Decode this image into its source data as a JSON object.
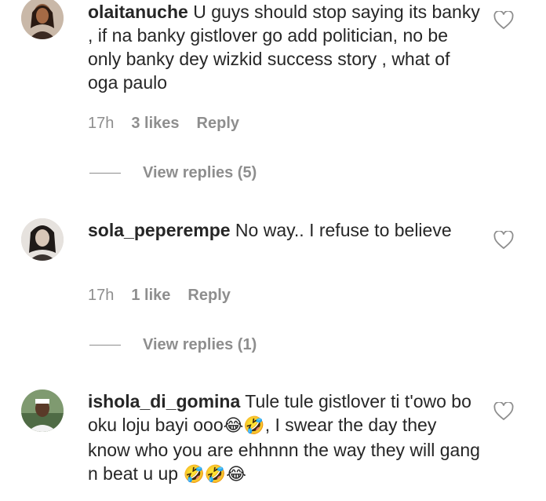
{
  "comments": [
    {
      "username": "olaitanuche",
      "text": "U guys should stop saying its banky , if na banky gistlover go add politician, no be only banky dey wizkid success story , what of oga paulo",
      "time": "17h",
      "likes": "3 likes",
      "reply_label": "Reply",
      "view_replies": "View replies (5)"
    },
    {
      "username": "sola_peperempe",
      "text": "No way.. I refuse to believe",
      "time": "17h",
      "likes": "1 like",
      "reply_label": "Reply",
      "view_replies": "View replies (1)"
    },
    {
      "username": "ishola_di_gomina",
      "text_part1": "Tule tule gistlover ti t'owo bo oku loju bayi ooo",
      "emoji_a": "😂🤣",
      "text_part2": ", I swear the day they know who you are ehhnnn the way they will gang n beat u up",
      "emoji_b": "🤣🤣😂"
    }
  ],
  "icons": {
    "like": "heart-outline-icon"
  },
  "colors": {
    "text": "#262626",
    "meta": "#8e8e8e"
  }
}
